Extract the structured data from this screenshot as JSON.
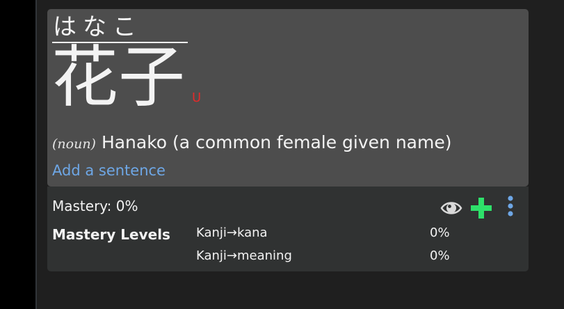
{
  "entry": {
    "reading": "はなこ",
    "kanji": "花子",
    "common_tag": "U",
    "part_of_speech": "(noun)",
    "meaning": "Hanako (a common female given name)",
    "add_sentence_label": "Add a sentence"
  },
  "mastery": {
    "summary": "Mastery: 0%",
    "levels_label": "Mastery Levels",
    "levels": [
      {
        "name": "Kanji→kana",
        "percent": "0%"
      },
      {
        "name": "Kanji→meaning",
        "percent": "0%"
      }
    ]
  },
  "icons": {
    "visibility": "eye-icon",
    "add": "plus-icon",
    "menu": "vertical-dots-icon"
  },
  "colors": {
    "accent_link": "#6ea7e6",
    "add_green": "#2ee06a",
    "menu_blue": "#6ea7e6",
    "common_red": "#e02b2b"
  }
}
